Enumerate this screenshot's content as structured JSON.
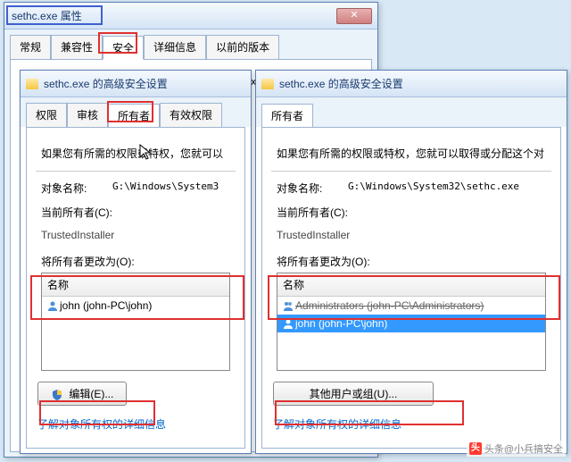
{
  "props_window": {
    "title": "sethc.exe 属性",
    "tabs": [
      "常规",
      "兼容性",
      "安全",
      "详细信息",
      "以前的版本"
    ],
    "active_tab": "安全",
    "object_label": "对象名称:",
    "object_value": "G:\\Windows\\System32\\sethc.exe"
  },
  "adv_window": {
    "title_prefix": "sethc.exe 的高级安全设置",
    "tabs": [
      "权限",
      "审核",
      "所有者",
      "有效权限"
    ],
    "active_tab": "所有者",
    "desc_left": "如果您有所需的权限或特权，您就可以",
    "desc_right": "如果您有所需的权限或特权，您就可以取得或分配这个对",
    "object_label": "对象名称:",
    "object_left": "G:\\Windows\\System3",
    "object_right": "G:\\Windows\\System32\\sethc.exe",
    "current_owner_label": "当前所有者(C):",
    "current_owner": "TrustedInstaller",
    "change_to_label": "将所有者更改为(O):",
    "name_header": "名称",
    "list_left": [
      {
        "text": "john (john-PC\\john)",
        "sel": false
      }
    ],
    "list_right": [
      {
        "text": "Administrators (john-PC\\Administrators)",
        "sel": false,
        "strike": true
      },
      {
        "text": "john (john-PC\\john)",
        "sel": true
      }
    ],
    "edit_btn": "编辑(E)...",
    "other_btn": "其他用户或组(U)...",
    "link_text": "了解对象所有权的详细信息"
  },
  "watermark": "头条@小兵搞安全"
}
